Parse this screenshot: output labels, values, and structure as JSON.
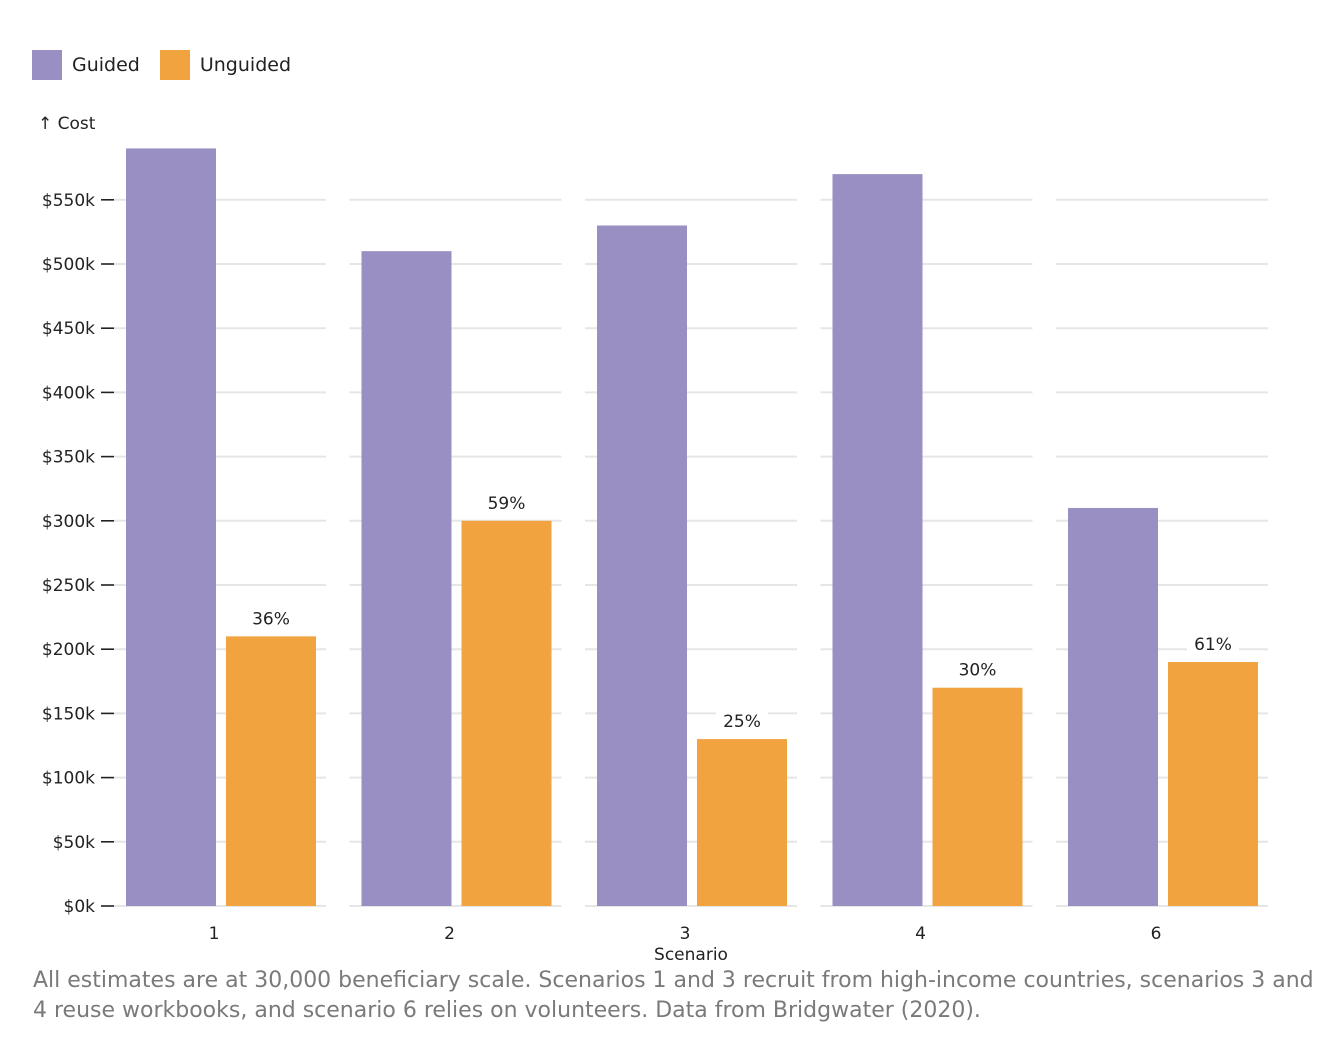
{
  "chart_data": {
    "type": "bar",
    "title": "",
    "xlabel": "Scenario",
    "ylabel": "↑ Cost",
    "ylim": [
      0,
      590000
    ],
    "yticks": [
      0,
      50000,
      100000,
      150000,
      200000,
      250000,
      300000,
      350000,
      400000,
      450000,
      500000,
      550000
    ],
    "ytick_labels": [
      "$0k",
      "$50k",
      "$100k",
      "$150k",
      "$200k",
      "$250k",
      "$300k",
      "$350k",
      "$400k",
      "$450k",
      "$500k",
      "$550k"
    ],
    "grid": true,
    "legend_position": "top-left",
    "categories": [
      "1",
      "2",
      "3",
      "4",
      "6"
    ],
    "series": [
      {
        "name": "Guided",
        "color": "#9a8fc3",
        "values": [
          590000,
          510000,
          530000,
          570000,
          310000
        ]
      },
      {
        "name": "Unguided",
        "color": "#f1a340",
        "values": [
          210000,
          300000,
          130000,
          170000,
          190000
        ],
        "labels": [
          "36%",
          "59%",
          "25%",
          "30%",
          "61%"
        ]
      }
    ]
  },
  "legend": [
    {
      "label": "Guided",
      "color": "#9a8fc3"
    },
    {
      "label": "Unguided",
      "color": "#f1a340"
    }
  ],
  "caption": "All estimates are at 30,000 beneficiary scale. Scenarios 1 and 3 recruit from high-income countries, scenarios 3 and 4 reuse workbooks, and scenario 6 relies on volunteers. Data from Bridgwater (2020)."
}
